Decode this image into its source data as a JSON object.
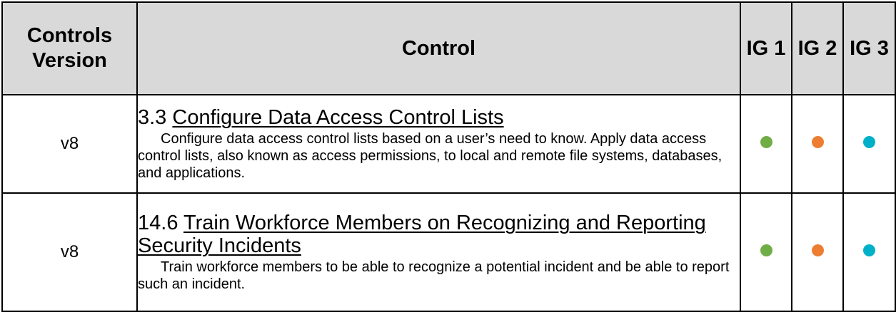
{
  "header": {
    "version": "Controls Version",
    "control": "Control",
    "ig1": "IG 1",
    "ig2": "IG 2",
    "ig3": "IG 3"
  },
  "rows": [
    {
      "version": "v8",
      "number": "3.3",
      "title": "Configure Data Access Control Lists",
      "description": "Configure data access control lists based on a user’s need to know. Apply data access control lists, also known as access permissions, to local and remote file systems, databases, and applications.",
      "ig1": "green-dot-icon",
      "ig2": "orange-dot-icon",
      "ig3": "teal-dot-icon"
    },
    {
      "version": "v8",
      "number": "14.6",
      "title": "Train Workforce Members on Recognizing and Reporting Security Incidents",
      "description": "Train workforce members to be able to recognize a potential incident and be able to report such an incident.",
      "ig1": "green-dot-icon",
      "ig2": "orange-dot-icon",
      "ig3": "teal-dot-icon"
    }
  ],
  "colors": {
    "header_bg": "#d9d9d9",
    "ig1": "#70ad47",
    "ig2": "#ed7d31",
    "ig3": "#00b0c8"
  }
}
